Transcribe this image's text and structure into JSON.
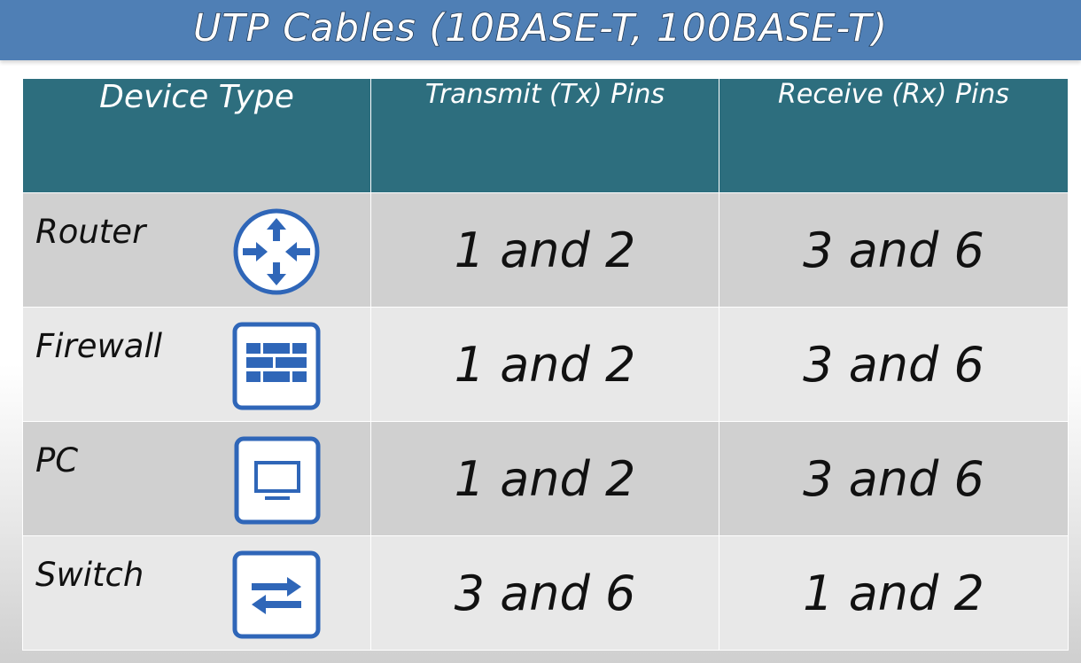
{
  "title": "UTP Cables (10BASE-T, 100BASE-T)",
  "headers": {
    "device_type": "Device Type",
    "transmit": "Transmit (Tx) Pins",
    "receive": "Receive (Rx) Pins"
  },
  "rows": [
    {
      "device": "Router",
      "icon": "router-icon",
      "tx": "1 and 2",
      "rx": "3 and 6"
    },
    {
      "device": "Firewall",
      "icon": "firewall-icon",
      "tx": "1 and 2",
      "rx": "3 and 6"
    },
    {
      "device": "PC",
      "icon": "pc-icon",
      "tx": "1 and 2",
      "rx": "3 and 6"
    },
    {
      "device": "Switch",
      "icon": "switch-icon",
      "tx": "3 and 6",
      "rx": "1 and 2"
    }
  ],
  "colors": {
    "title_bar": "#4f7fb5",
    "header_bg": "#2d6e7e",
    "row_dark": "#d0d0d0",
    "row_light": "#e8e8e8",
    "icon_blue": "#2f66b8"
  }
}
